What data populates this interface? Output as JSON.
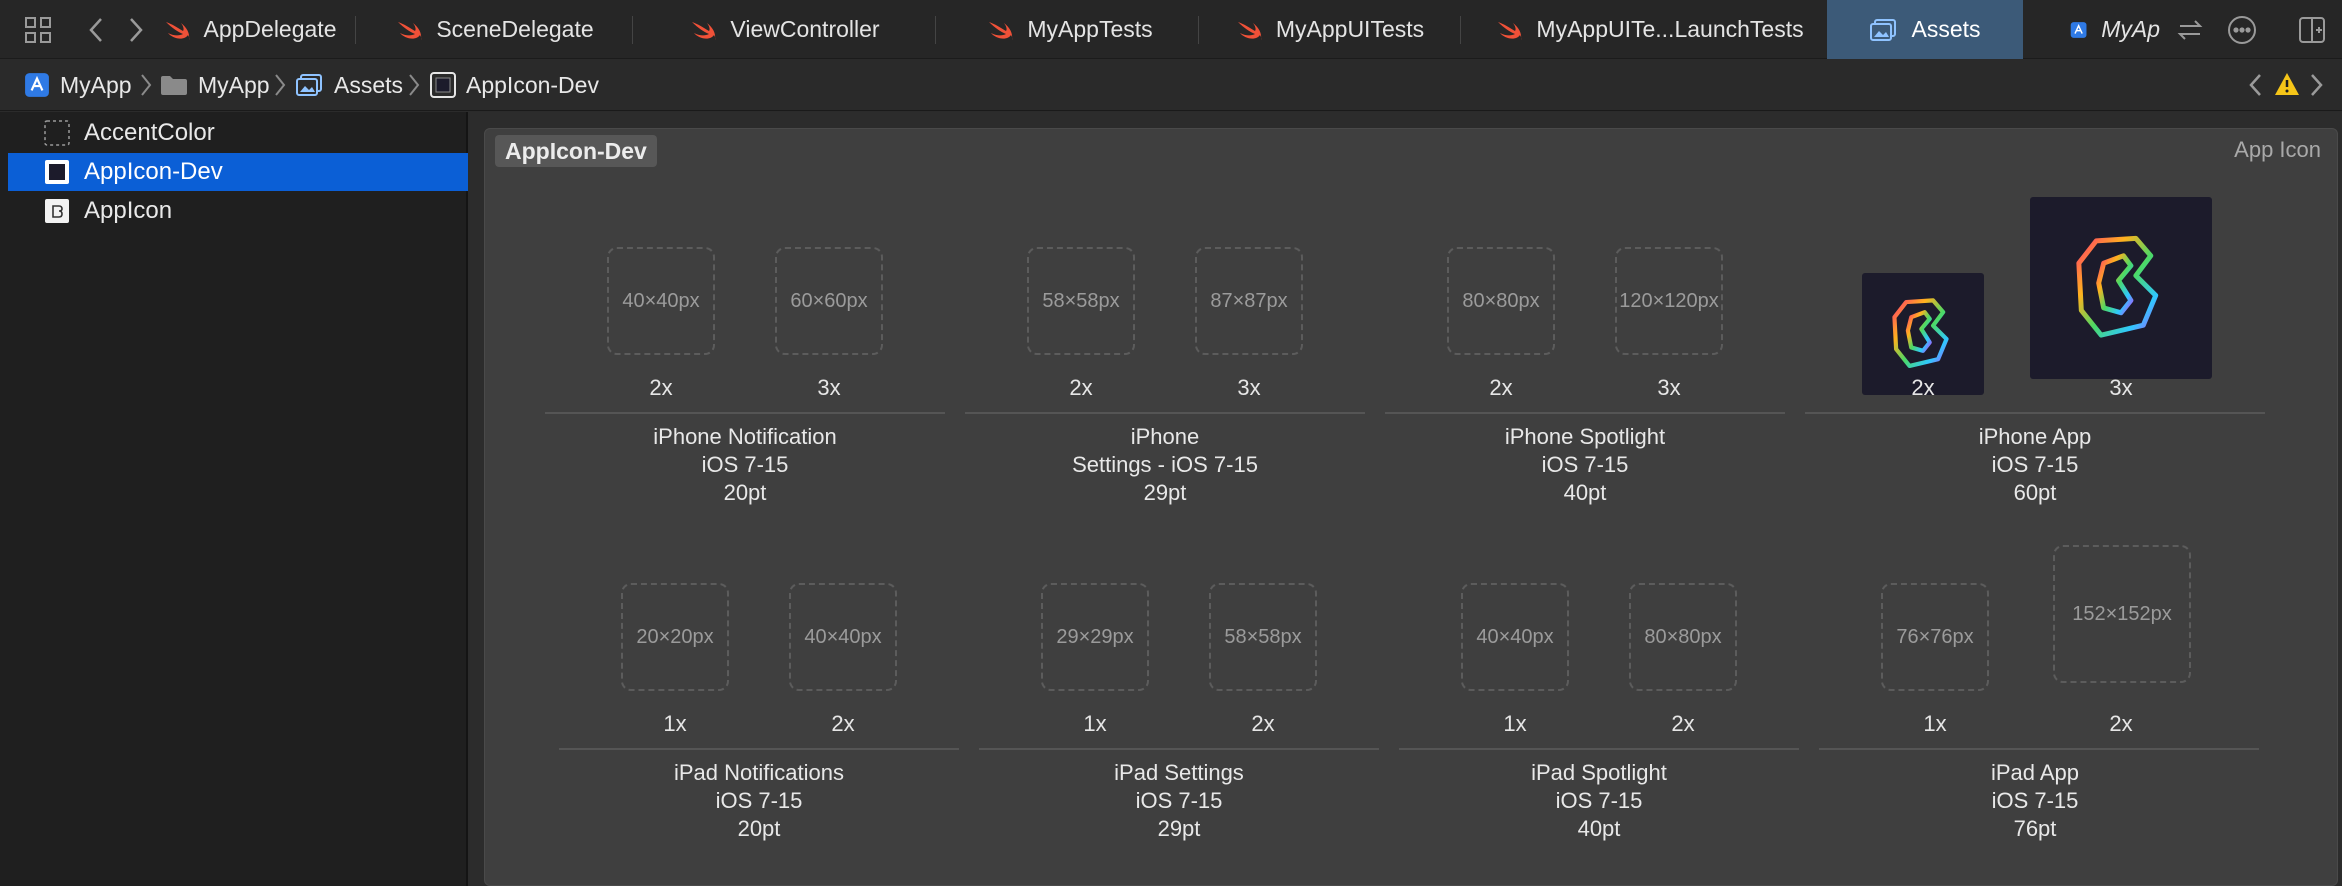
{
  "tabbar": {
    "tabs": [
      {
        "label": "AppDelegate",
        "type": "swift"
      },
      {
        "label": "SceneDelegate",
        "type": "swift"
      },
      {
        "label": "ViewController",
        "type": "swift"
      },
      {
        "label": "MyAppTests",
        "type": "swift"
      },
      {
        "label": "MyAppUITests",
        "type": "swift"
      },
      {
        "label": "MyAppUITe...LaunchTests",
        "type": "swift"
      },
      {
        "label": "Assets",
        "type": "assets",
        "active": true
      },
      {
        "label": "MyAp",
        "type": "project"
      }
    ]
  },
  "breadcrumb": {
    "items": [
      {
        "label": "MyApp",
        "icon": "project-icon"
      },
      {
        "label": "MyApp",
        "icon": "folder-icon"
      },
      {
        "label": "Assets",
        "icon": "asset-catalog-icon"
      },
      {
        "label": "AppIcon-Dev",
        "icon": "app-icon-set-icon"
      }
    ]
  },
  "sidebar": {
    "items": [
      {
        "label": "AccentColor",
        "icon": "color-set-icon"
      },
      {
        "label": "AppIcon-Dev",
        "icon": "app-icon-set-icon",
        "selected": true
      },
      {
        "label": "AppIcon",
        "icon": "app-icon-set-icon"
      }
    ]
  },
  "editor": {
    "set_name": "AppIcon-Dev",
    "set_type": "App Icon",
    "row1": [
      {
        "slots": [
          {
            "placeholder": "40×40px",
            "scale": "2x"
          },
          {
            "placeholder": "60×60px",
            "scale": "3x"
          }
        ],
        "caption": [
          "iPhone Notification",
          "iOS 7-15",
          "20pt"
        ]
      },
      {
        "slots": [
          {
            "placeholder": "58×58px",
            "scale": "2x"
          },
          {
            "placeholder": "87×87px",
            "scale": "3x"
          }
        ],
        "caption": [
          "iPhone",
          "Settings - iOS 7-15",
          "29pt"
        ]
      },
      {
        "slots": [
          {
            "placeholder": "80×80px",
            "scale": "2x"
          },
          {
            "placeholder": "120×120px",
            "scale": "3x"
          }
        ],
        "caption": [
          "iPhone Spotlight",
          "iOS 7-15",
          "40pt"
        ]
      },
      {
        "slots": [
          {
            "placeholder": "",
            "scale": "2x",
            "filled": true
          },
          {
            "placeholder": "",
            "scale": "3x",
            "filled": true
          }
        ],
        "caption": [
          "iPhone App",
          "iOS 7-15",
          "60pt"
        ]
      }
    ],
    "row2": [
      {
        "slots": [
          {
            "placeholder": "20×20px",
            "scale": "1x"
          },
          {
            "placeholder": "40×40px",
            "scale": "2x"
          }
        ],
        "caption": [
          "iPad Notifications",
          "iOS 7-15",
          "20pt"
        ]
      },
      {
        "slots": [
          {
            "placeholder": "29×29px",
            "scale": "1x"
          },
          {
            "placeholder": "58×58px",
            "scale": "2x"
          }
        ],
        "caption": [
          "iPad Settings",
          "iOS 7-15",
          "29pt"
        ]
      },
      {
        "slots": [
          {
            "placeholder": "40×40px",
            "scale": "1x"
          },
          {
            "placeholder": "80×80px",
            "scale": "2x"
          }
        ],
        "caption": [
          "iPad Spotlight",
          "iOS 7-15",
          "40pt"
        ]
      },
      {
        "slots": [
          {
            "placeholder": "76×76px",
            "scale": "1x"
          },
          {
            "placeholder": "152×152px",
            "scale": "2x"
          }
        ],
        "caption": [
          "iPad App",
          "iOS 7-15",
          "76pt"
        ]
      }
    ]
  },
  "colors": {
    "swift_orange": "#f05138",
    "active_tab": "#3c5a78",
    "selection_blue": "#0b5fd6",
    "warning_yellow": "#f5c518"
  }
}
